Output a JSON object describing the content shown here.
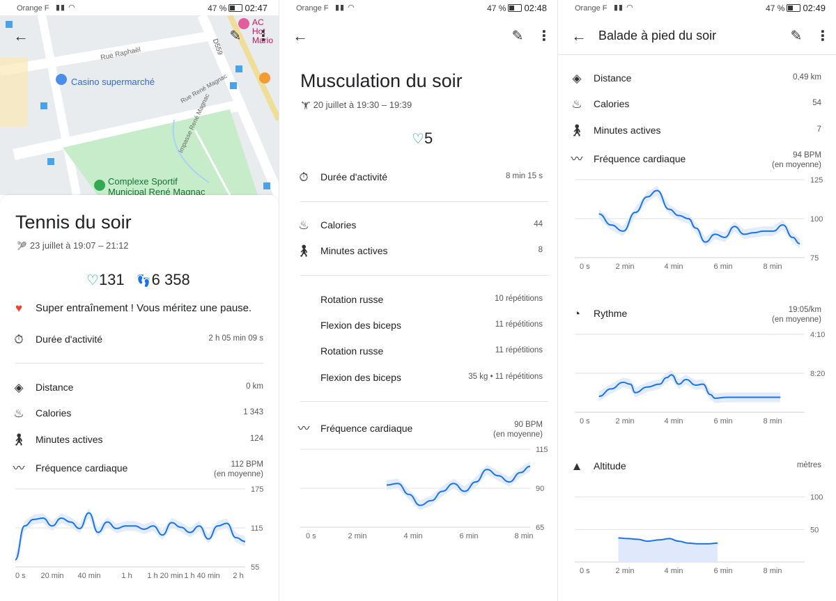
{
  "panel1": {
    "status": {
      "carrier": "Orange F",
      "battery": "47 %",
      "time": "02:47"
    },
    "map": {
      "poi_casino": "Casino supermarché",
      "poi_complexe_1": "Complexe Sportif",
      "poi_complexe_2": "Municipal René Magnac",
      "street_raphael": "Rue Raphaël",
      "street_impasse": "Impasse René Magnac",
      "street_magnac": "Rue René Magnac",
      "road_d559": "D559",
      "poi_ac_1": "AC Hot",
      "poi_ac_2": "Mario"
    },
    "title": "Tennis du soir",
    "date": "23 juillet à 19:07 – 21:12",
    "heart_points": "131",
    "steps": "6 358",
    "message": "Super entraînement ! Vous méritez une pause.",
    "rows": {
      "duration_label": "Durée d'activité",
      "duration_value": "2 h 05 min 09 s",
      "distance_label": "Distance",
      "distance_value": "0 km",
      "calories_label": "Calories",
      "calories_value": "1 343",
      "active_label": "Minutes actives",
      "active_value": "124",
      "hr_label": "Fréquence cardiaque",
      "hr_value": "112 BPM",
      "hr_sub": "(en moyenne)"
    }
  },
  "panel2": {
    "status": {
      "carrier": "Orange F",
      "battery": "47 %",
      "time": "02:48"
    },
    "title": "Musculation du soir",
    "date": "20 juillet à 19:30 – 19:39",
    "heart_points": "5",
    "rows": {
      "duration_label": "Durée d'activité",
      "duration_value": "8 min 15 s",
      "calories_label": "Calories",
      "calories_value": "44",
      "active_label": "Minutes actives",
      "active_value": "8",
      "hr_label": "Fréquence cardiaque",
      "hr_value": "90 BPM",
      "hr_sub": "(en moyenne)"
    },
    "exercises": [
      {
        "name": "Rotation russe",
        "detail": "10 répétitions"
      },
      {
        "name": "Flexion des biceps",
        "detail": "11 répétitions"
      },
      {
        "name": "Rotation russe",
        "detail": "11 répétitions"
      },
      {
        "name": "Flexion des biceps",
        "detail": "35 kg • 11 répétitions"
      }
    ]
  },
  "panel3": {
    "status": {
      "carrier": "Orange F",
      "battery": "47 %",
      "time": "02:49"
    },
    "title": "Balade à pied du soir",
    "rows": {
      "distance_label": "Distance",
      "distance_value": "0,49 km",
      "calories_label": "Calories",
      "calories_value": "54",
      "active_label": "Minutes actives",
      "active_value": "7",
      "hr_label": "Fréquence cardiaque",
      "hr_value": "94 BPM",
      "hr_sub": "(en moyenne)",
      "pace_label": "Rythme",
      "pace_value": "19:05/km",
      "pace_sub": "(en moyenne)",
      "alt_label": "Altitude",
      "alt_value": "mètres"
    }
  },
  "colors": {
    "line": "#1a73e8",
    "band": "#dbe7fb",
    "heart": "#0fa3a3",
    "steps": "#1a73e8"
  },
  "chart_data": [
    {
      "type": "line",
      "name": "tennis-heart-rate",
      "xlabels": [
        "0 s",
        "20 min",
        "40 min",
        "1 h",
        "1 h 20 min",
        "1 h 40 min",
        "2 h"
      ],
      "yticks": [
        "175",
        "115",
        "55"
      ],
      "ylim": [
        55,
        175
      ],
      "xlim": [
        0,
        125
      ],
      "x": [
        0,
        5,
        10,
        15,
        20,
        25,
        30,
        35,
        40,
        45,
        50,
        55,
        60,
        65,
        70,
        75,
        80,
        85,
        90,
        95,
        100,
        105,
        110,
        115,
        120,
        125
      ],
      "values": [
        66,
        118,
        128,
        130,
        118,
        130,
        124,
        114,
        138,
        108,
        124,
        114,
        118,
        118,
        113,
        118,
        104,
        123,
        116,
        108,
        118,
        98,
        118,
        122,
        100,
        94
      ]
    },
    {
      "type": "line",
      "name": "musculation-heart-rate",
      "xlabels": [
        "0 s",
        "2 min",
        "4 min",
        "6 min",
        "8 min"
      ],
      "yticks": [
        "115",
        "90",
        "65"
      ],
      "ylim": [
        65,
        115
      ],
      "xlim": [
        0,
        8.25
      ],
      "x": [
        3.1,
        3.5,
        3.9,
        4.3,
        4.7,
        5.1,
        5.5,
        5.9,
        6.3,
        6.7,
        7.1,
        7.5,
        7.9,
        8.25
      ],
      "values": [
        92,
        93,
        86,
        79,
        82,
        88,
        93,
        88,
        94,
        102,
        98,
        94,
        100,
        104
      ]
    },
    {
      "type": "line",
      "name": "balade-heart-rate",
      "xlabels": [
        "0 s",
        "2 min",
        "4 min",
        "6 min",
        "8 min"
      ],
      "yticks": [
        "125",
        "100",
        "75"
      ],
      "ylim": [
        75,
        125
      ],
      "xlim": [
        0,
        9.5
      ],
      "x": [
        1,
        1.5,
        2,
        2.5,
        3,
        3.4,
        3.9,
        4.3,
        4.7,
        5,
        5.4,
        5.8,
        6.2,
        6.6,
        7,
        7.4,
        7.8,
        8.2,
        8.6,
        9,
        9.3
      ],
      "values": [
        103,
        96,
        92,
        104,
        114,
        118,
        106,
        102,
        100,
        94,
        85,
        90,
        88,
        95,
        90,
        91,
        92,
        92,
        96,
        88,
        84
      ]
    },
    {
      "type": "line",
      "name": "balade-pace",
      "xlabels": [
        "0 s",
        "2 min",
        "4 min",
        "6 min",
        "8 min"
      ],
      "yticks": [
        "4:10",
        "8:20"
      ],
      "xlim": [
        0,
        9.5
      ],
      "x": [
        1,
        1.5,
        2,
        2.3,
        2.5,
        3,
        3.5,
        3.8,
        4,
        4.3,
        4.6,
        5,
        5.3,
        5.6,
        5.8,
        6.3,
        7,
        8,
        8.5
      ],
      "values": [
        10.8,
        10.0,
        9.3,
        9.5,
        10.4,
        9.8,
        9.5,
        8.8,
        8.5,
        9.5,
        9.0,
        9.6,
        9.5,
        10.6,
        11.0,
        10.9,
        10.9,
        10.9,
        10.9
      ]
    },
    {
      "type": "area",
      "name": "balade-altitude",
      "xlabels": [
        "0 s",
        "2 min",
        "4 min",
        "6 min",
        "8 min"
      ],
      "yticks": [
        "100",
        "50"
      ],
      "ylim": [
        0,
        120
      ],
      "xlim": [
        0,
        9.5
      ],
      "x": [
        1.8,
        2.2,
        2.6,
        3,
        3.5,
        3.9,
        4.3,
        4.7,
        5.1,
        5.5,
        5.9
      ],
      "values": [
        37,
        36,
        35,
        32,
        34,
        36,
        32,
        29,
        28,
        28,
        29
      ]
    }
  ]
}
